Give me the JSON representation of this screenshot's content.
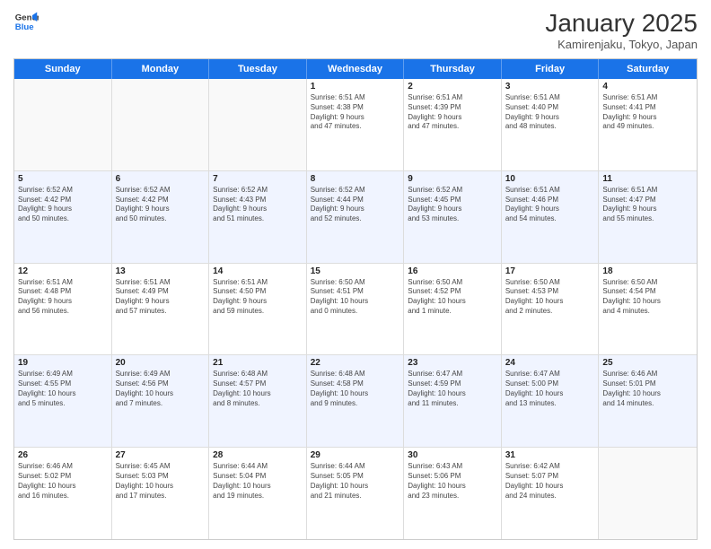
{
  "logo": {
    "line1": "General",
    "line2": "Blue"
  },
  "title": "January 2025",
  "subtitle": "Kamirenjaku, Tokyo, Japan",
  "header_days": [
    "Sunday",
    "Monday",
    "Tuesday",
    "Wednesday",
    "Thursday",
    "Friday",
    "Saturday"
  ],
  "rows": [
    [
      {
        "day": "",
        "text": "",
        "empty": true
      },
      {
        "day": "",
        "text": "",
        "empty": true
      },
      {
        "day": "",
        "text": "",
        "empty": true
      },
      {
        "day": "1",
        "text": "Sunrise: 6:51 AM\nSunset: 4:38 PM\nDaylight: 9 hours\nand 47 minutes."
      },
      {
        "day": "2",
        "text": "Sunrise: 6:51 AM\nSunset: 4:39 PM\nDaylight: 9 hours\nand 47 minutes."
      },
      {
        "day": "3",
        "text": "Sunrise: 6:51 AM\nSunset: 4:40 PM\nDaylight: 9 hours\nand 48 minutes."
      },
      {
        "day": "4",
        "text": "Sunrise: 6:51 AM\nSunset: 4:41 PM\nDaylight: 9 hours\nand 49 minutes."
      }
    ],
    [
      {
        "day": "5",
        "text": "Sunrise: 6:52 AM\nSunset: 4:42 PM\nDaylight: 9 hours\nand 50 minutes."
      },
      {
        "day": "6",
        "text": "Sunrise: 6:52 AM\nSunset: 4:42 PM\nDaylight: 9 hours\nand 50 minutes."
      },
      {
        "day": "7",
        "text": "Sunrise: 6:52 AM\nSunset: 4:43 PM\nDaylight: 9 hours\nand 51 minutes."
      },
      {
        "day": "8",
        "text": "Sunrise: 6:52 AM\nSunset: 4:44 PM\nDaylight: 9 hours\nand 52 minutes."
      },
      {
        "day": "9",
        "text": "Sunrise: 6:52 AM\nSunset: 4:45 PM\nDaylight: 9 hours\nand 53 minutes."
      },
      {
        "day": "10",
        "text": "Sunrise: 6:51 AM\nSunset: 4:46 PM\nDaylight: 9 hours\nand 54 minutes."
      },
      {
        "day": "11",
        "text": "Sunrise: 6:51 AM\nSunset: 4:47 PM\nDaylight: 9 hours\nand 55 minutes."
      }
    ],
    [
      {
        "day": "12",
        "text": "Sunrise: 6:51 AM\nSunset: 4:48 PM\nDaylight: 9 hours\nand 56 minutes."
      },
      {
        "day": "13",
        "text": "Sunrise: 6:51 AM\nSunset: 4:49 PM\nDaylight: 9 hours\nand 57 minutes."
      },
      {
        "day": "14",
        "text": "Sunrise: 6:51 AM\nSunset: 4:50 PM\nDaylight: 9 hours\nand 59 minutes."
      },
      {
        "day": "15",
        "text": "Sunrise: 6:50 AM\nSunset: 4:51 PM\nDaylight: 10 hours\nand 0 minutes."
      },
      {
        "day": "16",
        "text": "Sunrise: 6:50 AM\nSunset: 4:52 PM\nDaylight: 10 hours\nand 1 minute."
      },
      {
        "day": "17",
        "text": "Sunrise: 6:50 AM\nSunset: 4:53 PM\nDaylight: 10 hours\nand 2 minutes."
      },
      {
        "day": "18",
        "text": "Sunrise: 6:50 AM\nSunset: 4:54 PM\nDaylight: 10 hours\nand 4 minutes."
      }
    ],
    [
      {
        "day": "19",
        "text": "Sunrise: 6:49 AM\nSunset: 4:55 PM\nDaylight: 10 hours\nand 5 minutes."
      },
      {
        "day": "20",
        "text": "Sunrise: 6:49 AM\nSunset: 4:56 PM\nDaylight: 10 hours\nand 7 minutes."
      },
      {
        "day": "21",
        "text": "Sunrise: 6:48 AM\nSunset: 4:57 PM\nDaylight: 10 hours\nand 8 minutes."
      },
      {
        "day": "22",
        "text": "Sunrise: 6:48 AM\nSunset: 4:58 PM\nDaylight: 10 hours\nand 9 minutes."
      },
      {
        "day": "23",
        "text": "Sunrise: 6:47 AM\nSunset: 4:59 PM\nDaylight: 10 hours\nand 11 minutes."
      },
      {
        "day": "24",
        "text": "Sunrise: 6:47 AM\nSunset: 5:00 PM\nDaylight: 10 hours\nand 13 minutes."
      },
      {
        "day": "25",
        "text": "Sunrise: 6:46 AM\nSunset: 5:01 PM\nDaylight: 10 hours\nand 14 minutes."
      }
    ],
    [
      {
        "day": "26",
        "text": "Sunrise: 6:46 AM\nSunset: 5:02 PM\nDaylight: 10 hours\nand 16 minutes."
      },
      {
        "day": "27",
        "text": "Sunrise: 6:45 AM\nSunset: 5:03 PM\nDaylight: 10 hours\nand 17 minutes."
      },
      {
        "day": "28",
        "text": "Sunrise: 6:44 AM\nSunset: 5:04 PM\nDaylight: 10 hours\nand 19 minutes."
      },
      {
        "day": "29",
        "text": "Sunrise: 6:44 AM\nSunset: 5:05 PM\nDaylight: 10 hours\nand 21 minutes."
      },
      {
        "day": "30",
        "text": "Sunrise: 6:43 AM\nSunset: 5:06 PM\nDaylight: 10 hours\nand 23 minutes."
      },
      {
        "day": "31",
        "text": "Sunrise: 6:42 AM\nSunset: 5:07 PM\nDaylight: 10 hours\nand 24 minutes."
      },
      {
        "day": "",
        "text": "",
        "empty": true
      }
    ]
  ]
}
